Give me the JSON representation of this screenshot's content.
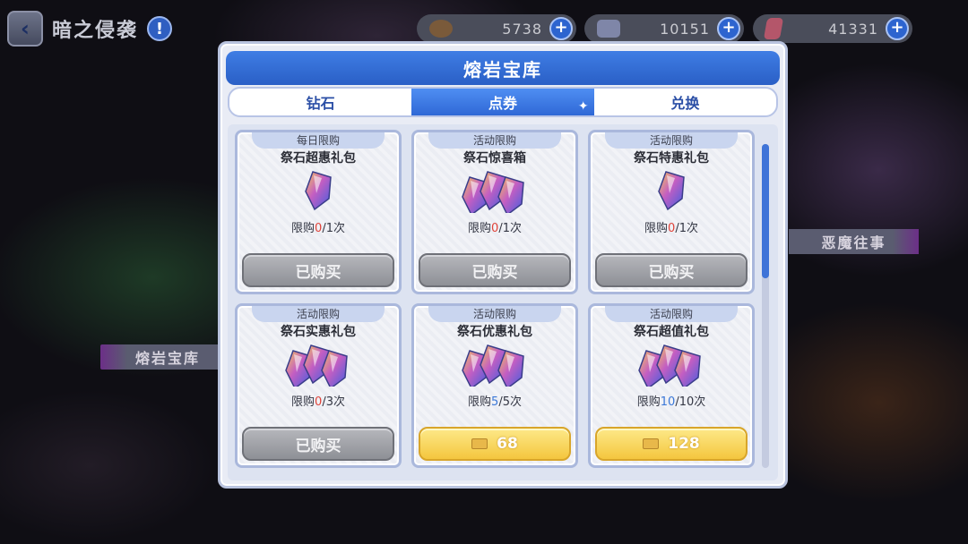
{
  "header": {
    "back_icon": "back-arrow-icon",
    "title": "暗之侵袭",
    "help_icon": "info-icon"
  },
  "resources": [
    {
      "icon": "stone-icon",
      "value": "5738",
      "color": "#7a5a3a"
    },
    {
      "icon": "ticket-icon",
      "value": "10151",
      "color": "#7f86a8"
    },
    {
      "icon": "crystal-icon",
      "value": "41331",
      "color": "#b4566a"
    }
  ],
  "map_labels": {
    "lava": "熔岩宝库",
    "demon": "恶魔往事"
  },
  "modal": {
    "title": "熔岩宝库",
    "tabs": [
      {
        "label": "钻石",
        "active": false
      },
      {
        "label": "点券",
        "active": true
      },
      {
        "label": "兑换",
        "active": false
      }
    ],
    "items": [
      {
        "tag": "每日限购",
        "name": "祭石超惠礼包",
        "gems": 1,
        "limit_prefix": "限购",
        "limit_cur": "0",
        "limit_total": "/1次",
        "button": "已购买",
        "button_state": "disabled"
      },
      {
        "tag": "活动限购",
        "name": "祭石惊喜箱",
        "gems": 3,
        "limit_prefix": "限购",
        "limit_cur": "0",
        "limit_total": "/1次",
        "button": "已购买",
        "button_state": "disabled"
      },
      {
        "tag": "活动限购",
        "name": "祭石特惠礼包",
        "gems": 1,
        "limit_prefix": "限购",
        "limit_cur": "0",
        "limit_total": "/1次",
        "button": "已购买",
        "button_state": "disabled"
      },
      {
        "tag": "活动限购",
        "name": "祭石实惠礼包",
        "gems": 3,
        "limit_prefix": "限购",
        "limit_cur": "0",
        "limit_total": "/3次",
        "button": "已购买",
        "button_state": "disabled"
      },
      {
        "tag": "活动限购",
        "name": "祭石优惠礼包",
        "gems": 3,
        "limit_prefix": "限购",
        "limit_cur": "5",
        "limit_total": "/5次",
        "button": "68",
        "button_state": "price"
      },
      {
        "tag": "活动限购",
        "name": "祭石超值礼包",
        "gems": 3,
        "limit_prefix": "限购",
        "limit_cur": "10",
        "limit_total": "/10次",
        "button": "128",
        "button_state": "price"
      }
    ]
  },
  "colors": {
    "accent": "#2f68d6",
    "limit_red": "#e0443a",
    "limit_blue": "#3b78d8",
    "price_gold": "#f4c63e"
  }
}
